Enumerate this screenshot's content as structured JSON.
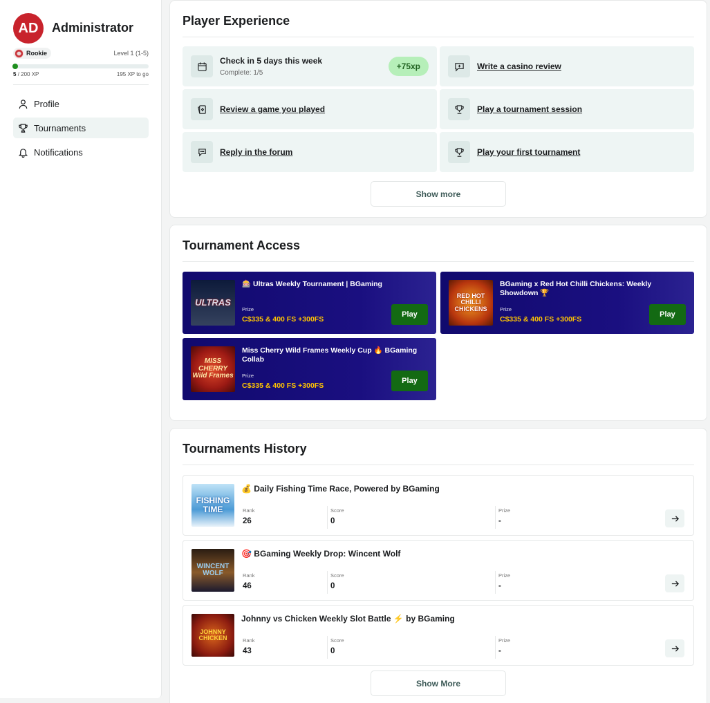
{
  "profile": {
    "initials": "AD",
    "name": "Administrator",
    "rank": "Rookie",
    "level": "Level 1 (1-5)",
    "xp_current": "5",
    "xp_total": "/ 200 XP",
    "xp_togo": "195 XP to go",
    "xp_progress": 0.025
  },
  "nav": [
    {
      "label": "Profile",
      "icon": "user-icon"
    },
    {
      "label": "Tournaments",
      "icon": "trophy-icon",
      "active": true
    },
    {
      "label": "Notifications",
      "icon": "bell-icon"
    }
  ],
  "player_experience": {
    "title": "Player Experience",
    "tasks": [
      {
        "title": "Check in 5 days this week",
        "sub": "Complete: 1/5",
        "badge": "+75xp",
        "icon": "calendar-icon"
      },
      {
        "title": "Write a casino review",
        "icon": "chat-plus-icon"
      },
      {
        "title": "Review a game you played",
        "icon": "cards-icon"
      },
      {
        "title": "Play a tournament session",
        "icon": "trophy-icon"
      },
      {
        "title": "Reply in the forum",
        "icon": "forum-icon"
      },
      {
        "title": "Play your first tournament",
        "icon": "trophy-icon"
      }
    ],
    "show_more": "Show more"
  },
  "tournament_access": {
    "title": "Tournament Access",
    "prize_label": "Prize",
    "play_label": "Play",
    "items": [
      {
        "name": "🎰 Ultras Weekly Tournament | BGaming",
        "prize": "C$335 & 400 FS +300FS",
        "thumb": "ULTRAS"
      },
      {
        "name": "BGaming x Red Hot Chilli Chickens: Weekly Showdown 🏆",
        "prize": "C$335 & 400 FS +300FS",
        "thumb": "RED HOT CHILLI CHICKENS"
      },
      {
        "name": "Miss Cherry Wild Frames Weekly Cup 🔥 BGaming Collab",
        "prize": "C$335 & 400 FS +300FS",
        "thumb": "MISS CHERRY Wild Frames"
      }
    ]
  },
  "history": {
    "title": "Tournaments History",
    "rank_label": "Rank",
    "score_label": "Score",
    "prize_label": "Prize",
    "rows": [
      {
        "title": "💰 Daily Fishing Time Race, Powered by BGaming",
        "rank": "26",
        "score": "0",
        "prize": "-",
        "thumb": "FISHING TIME"
      },
      {
        "title": "🎯 BGaming Weekly Drop: Wincent Wolf",
        "rank": "46",
        "score": "0",
        "prize": "-",
        "thumb": "WINCENT WOLF"
      },
      {
        "title": "Johnny vs Chicken Weekly Slot Battle ⚡ by BGaming",
        "rank": "43",
        "score": "0",
        "prize": "-",
        "thumb": "JOHNNY CHICKEN"
      }
    ],
    "show_more": "Show More"
  },
  "colors": {
    "accent_green": "#136a13",
    "avatar_red": "#c8232c",
    "card_navy": "#110a6e",
    "prize_gold": "#ffc400"
  }
}
